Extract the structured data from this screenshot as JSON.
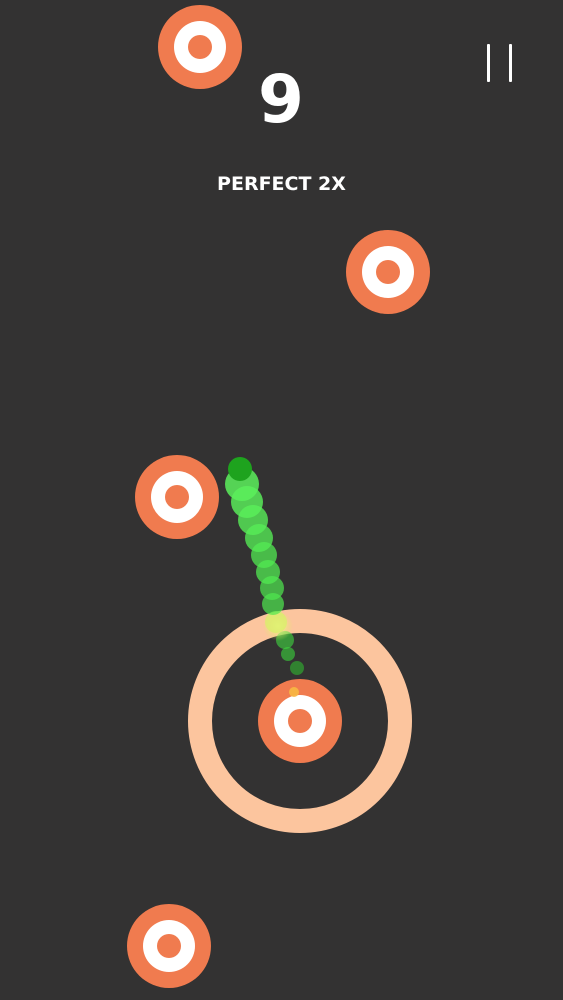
{
  "hud": {
    "score": "9",
    "combo_text": "PERFECT 2X"
  },
  "pause_icon": "pause-icon",
  "colors": {
    "background": "#333232",
    "target_orange": "#f07b4f",
    "target_white": "#ffffff",
    "active_ring": "#fcc59e",
    "ball_green": "#2ddc2d",
    "trail_green": "#4ee84e",
    "hud_text": "#ffffff"
  }
}
